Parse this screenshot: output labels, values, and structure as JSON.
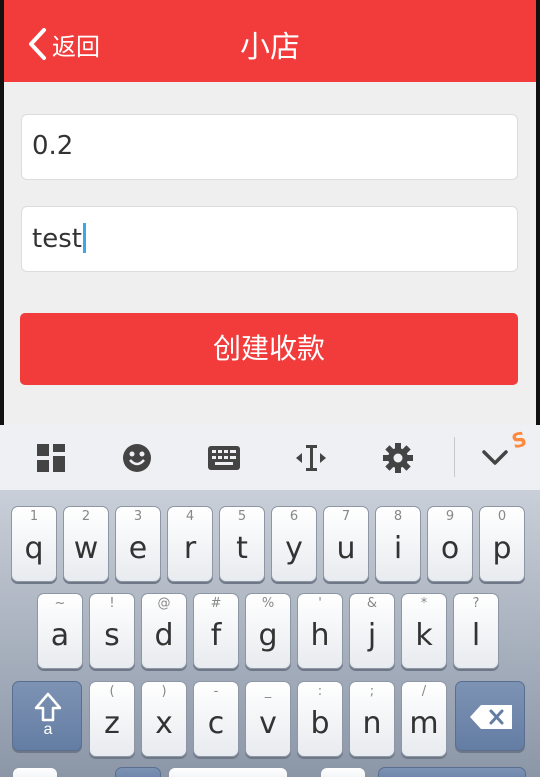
{
  "header": {
    "back_label": "返回",
    "title": "小店"
  },
  "form": {
    "amount_value": "0.2",
    "note_value": "test",
    "submit_label": "创建收款"
  },
  "toolbar": {
    "icons": [
      "grid-icon",
      "emoji-icon",
      "keyboard-icon",
      "cursor-icon",
      "gear-icon",
      "collapse-chevron-icon"
    ],
    "brand_mark": "S"
  },
  "keyboard": {
    "row1": [
      {
        "sub": "1",
        "main": "q"
      },
      {
        "sub": "2",
        "main": "w"
      },
      {
        "sub": "3",
        "main": "e"
      },
      {
        "sub": "4",
        "main": "r"
      },
      {
        "sub": "5",
        "main": "t"
      },
      {
        "sub": "6",
        "main": "y"
      },
      {
        "sub": "7",
        "main": "u"
      },
      {
        "sub": "8",
        "main": "i"
      },
      {
        "sub": "9",
        "main": "o"
      },
      {
        "sub": "0",
        "main": "p"
      }
    ],
    "row2": [
      {
        "sub": "~",
        "main": "a"
      },
      {
        "sub": "!",
        "main": "s"
      },
      {
        "sub": "@",
        "main": "d"
      },
      {
        "sub": "#",
        "main": "f"
      },
      {
        "sub": "%",
        "main": "g"
      },
      {
        "sub": "'",
        "main": "h"
      },
      {
        "sub": "&",
        "main": "j"
      },
      {
        "sub": "*",
        "main": "k"
      },
      {
        "sub": "?",
        "main": "l"
      }
    ],
    "row3": [
      {
        "sub": "(",
        "main": "z"
      },
      {
        "sub": ")",
        "main": "x"
      },
      {
        "sub": "-",
        "main": "c"
      },
      {
        "sub": "_",
        "main": "v"
      },
      {
        "sub": ":",
        "main": "b"
      },
      {
        "sub": ";",
        "main": "n"
      },
      {
        "sub": "/",
        "main": "m"
      }
    ],
    "shift_label": "a"
  },
  "colors": {
    "brand_red": "#f23b3b",
    "caret_blue": "#3aa7e8"
  }
}
